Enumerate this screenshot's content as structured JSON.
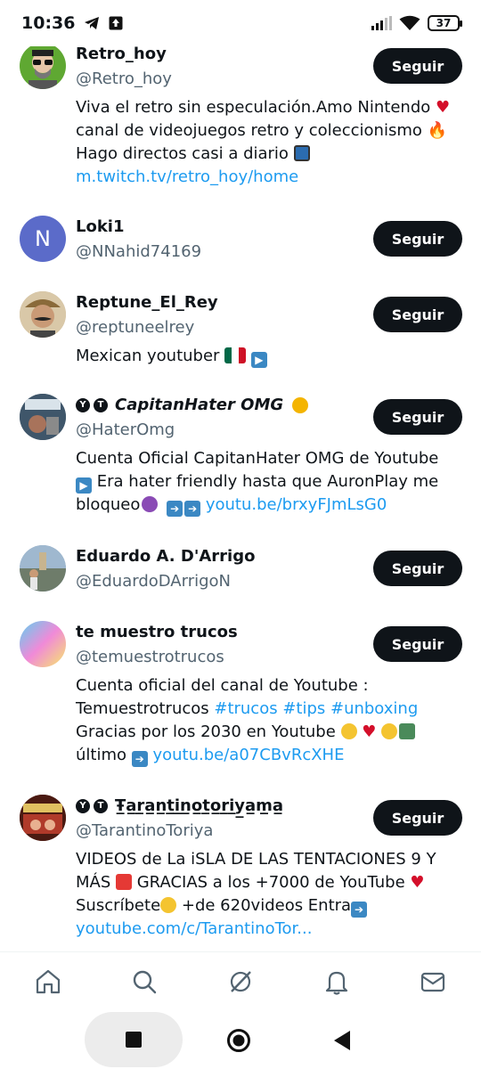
{
  "status_bar": {
    "time": "10:36",
    "battery": "37"
  },
  "accounts": [
    {
      "name": "Retro_hoy",
      "handle": "@Retro_hoy",
      "follow_label": "Seguir",
      "bio_1": "Viva el retro sin especulación.Amo Nintendo ",
      "bio_2": "canal de videojuegos retro y coleccionismo ",
      "bio_3": "Hago directos casi a diario ",
      "bio_link": "m.twitch.tv/retro_hoy/home"
    },
    {
      "name": "Loki1",
      "handle": "@NNahid74169",
      "follow_label": "Seguir",
      "avatar_letter": "N"
    },
    {
      "name": "Reptune_El_Rey",
      "handle": "@reptuneelrey",
      "follow_label": "Seguir",
      "bio_1": "Mexican youtuber "
    },
    {
      "name": "CapitanHater OMG",
      "handle": "@HaterOmg",
      "follow_label": "Seguir",
      "bio_1": "Cuenta Oficial CapitanHater OMG de Youtube",
      "bio_2": " Era hater friendly hasta que AuronPlay me",
      "bio_3": "bloqueo",
      "bio_link": "youtu.be/brxyFJmLsG0"
    },
    {
      "name": "Eduardo A. D'Arrigo",
      "handle": "@EduardoDArrigoN",
      "follow_label": "Seguir"
    },
    {
      "name": "te muestro trucos",
      "handle": "@temuestrotrucos",
      "follow_label": "Seguir",
      "bio_1": "Cuenta oficial del canal de Youtube :",
      "bio_2": "Temuestrotrucos ",
      "bio_tags": "#trucos #tips #unboxing",
      "bio_3": "Gracias por los 2030 en Youtube ",
      "bio_4": "último ",
      "bio_link": "youtu.be/a07CBvRcXHE"
    },
    {
      "name": "Ŧ̲a̲r̲a̲n̲t̲i̲n̲o̲t̲o̲r̲i̲y̲a̲m̲a̲",
      "handle": "@TarantinoToriya",
      "follow_label": "Seguir",
      "bio_1": "VIDEOS de La iSLA DE LAS TENTACIONES 9 Y",
      "bio_2": "MÁS ",
      "bio_2b": " GRACIAS a los +7000 de YouTube ",
      "bio_3": "Suscríbete",
      "bio_3b": " +de 620videos Entra",
      "bio_link": "youtube.com/c/TarantinoTor..."
    }
  ],
  "icons": {
    "nav": [
      "home-icon",
      "search-icon",
      "grok-icon",
      "notifications-icon",
      "messages-icon"
    ]
  },
  "colors": {
    "link": "#1d9bf0",
    "button": "#0f1419",
    "secondary": "#536471"
  }
}
